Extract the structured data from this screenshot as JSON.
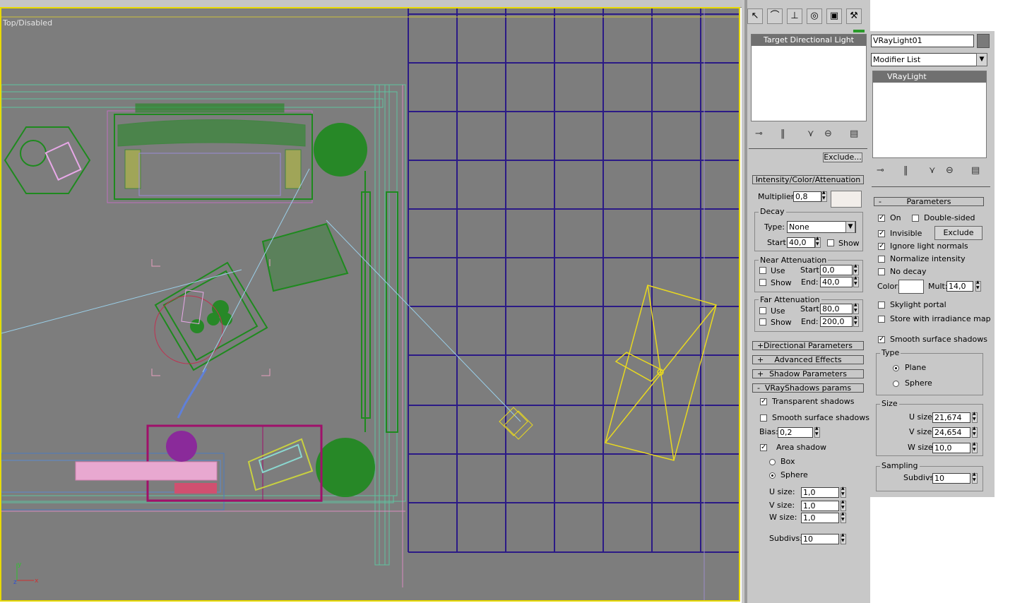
{
  "viewport": {
    "label": "Top/Disabled",
    "axes": {
      "x": "x",
      "y": "y"
    }
  },
  "command_panel": {
    "tabs": [
      "create-icon",
      "modify-icon",
      "hierarchy-icon",
      "motion-icon",
      "display-icon",
      "utilities-icon"
    ]
  },
  "left_panel": {
    "stack_item": "Target Directional Light",
    "exclude_button": "Exclude...",
    "intensity": {
      "title": "Intensity/Color/Attenuation",
      "multiplier_label": "Multiplier:",
      "multiplier_value": "0,8",
      "color": "#f2eeea",
      "decay_title": "Decay",
      "type_label": "Type:",
      "type_value": "None",
      "start_label": "Start:",
      "start_value": "40,0",
      "show_label": "Show",
      "near_title": "Near Attenuation",
      "near_use": "Use",
      "near_show": "Show",
      "near_start_label": "Start:",
      "near_start": "0,0",
      "near_end_label": "End:",
      "near_end": "40,0",
      "far_title": "Far Attenuation",
      "far_use": "Use",
      "far_show": "Show",
      "far_start_label": "Start:",
      "far_start": "80,0",
      "far_end_label": "End:",
      "far_end": "200,0"
    },
    "rollouts": {
      "directional": "Directional Parameters",
      "advanced": "Advanced Effects",
      "shadow": "Shadow Parameters",
      "vray": "VRayShadows params"
    },
    "vray_shadows": {
      "transparent": "Transparent shadows",
      "transparent_checked": true,
      "smooth": "Smooth surface shadows",
      "smooth_checked": false,
      "bias_label": "Bias:",
      "bias_value": "0,2",
      "area": "Area shadow",
      "area_checked": true,
      "box": "Box",
      "sphere": "Sphere",
      "selected": "Sphere",
      "u_label": "U size:",
      "u_value": "1,0",
      "v_label": "V size:",
      "v_value": "1,0",
      "w_label": "W size:",
      "w_value": "1,0",
      "subdivs_label": "Subdivs:",
      "subdivs_value": "10"
    }
  },
  "right_panel": {
    "object_name": "VRayLight01",
    "object_color": "#7a7a7a",
    "modifier_list": "Modifier List",
    "stack_item": "VRayLight",
    "parameters": {
      "title": "Parameters",
      "on": "On",
      "on_checked": true,
      "double_sided": "Double-sided",
      "double_sided_checked": false,
      "invisible": "Invisible",
      "invisible_checked": true,
      "exclude": "Exclude",
      "ignore_normals": "Ignore light normals",
      "ignore_normals_checked": true,
      "normalize": "Normalize intensity",
      "normalize_checked": false,
      "no_decay": "No decay",
      "no_decay_checked": false,
      "color_label": "Color:",
      "color": "#ffffff",
      "mult_label": "Mult:",
      "mult_value": "14,0",
      "skylight": "Skylight portal",
      "skylight_checked": false,
      "irradiance": "Store with irradiance map",
      "irradiance_checked": false,
      "smooth": "Smooth surface shadows",
      "smooth_checked": true,
      "type_title": "Type",
      "plane": "Plane",
      "sphere": "Sphere",
      "type_selected": "Plane",
      "size_title": "Size",
      "u_label": "U size:",
      "u_value": "21,674",
      "v_label": "V size:",
      "v_value": "24,654",
      "w_label": "W size:",
      "w_value": "10,0",
      "sampling_title": "Sampling",
      "subdivs_label": "Subdivs:",
      "subdivs_value": "10"
    }
  }
}
